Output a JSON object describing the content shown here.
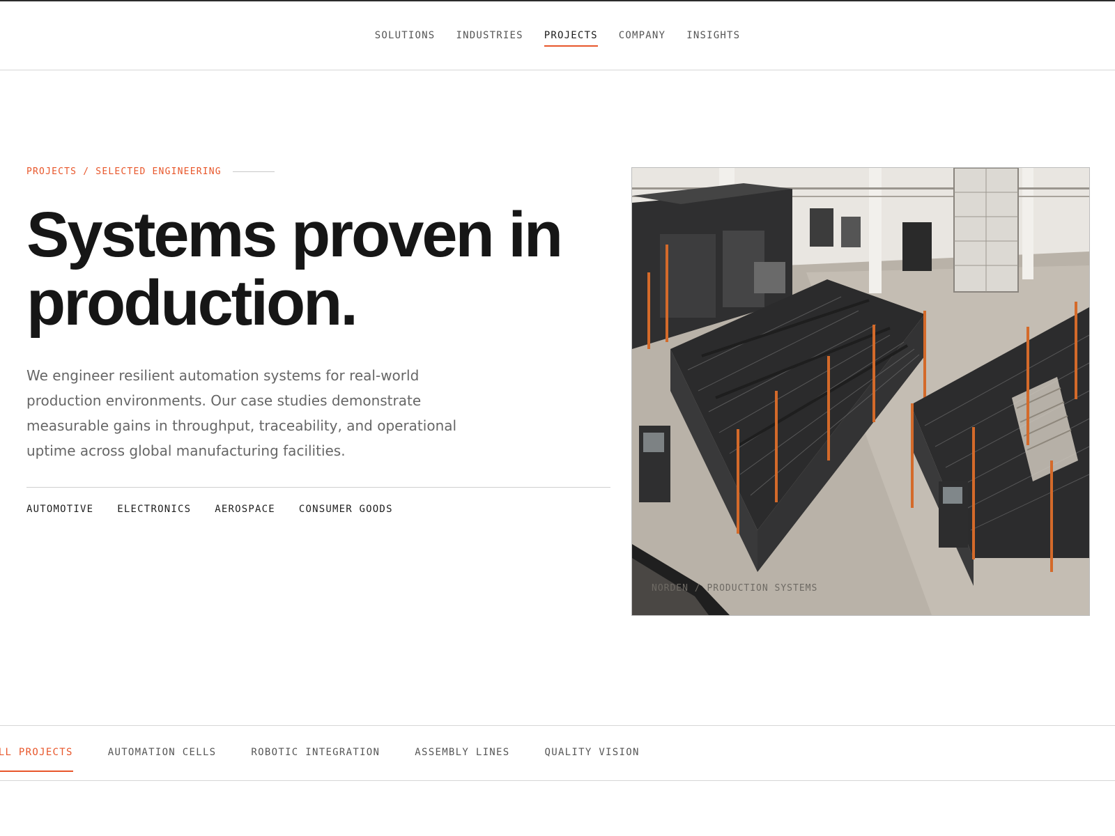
{
  "nav": {
    "items": [
      {
        "label": "SOLUTIONS",
        "active": false
      },
      {
        "label": "INDUSTRIES",
        "active": false
      },
      {
        "label": "PROJECTS",
        "active": true
      },
      {
        "label": "COMPANY",
        "active": false
      },
      {
        "label": "INSIGHTS",
        "active": false
      }
    ]
  },
  "hero": {
    "eyebrow": "PROJECTS / SELECTED ENGINEERING",
    "headline_line1": "Systems proven in",
    "headline_line2": "production.",
    "lede": "We engineer resilient automation systems for real-world production environments. Our case studies demonstrate measurable gains in throughput, traceability, and operational uptime across global manufacturing facilities.",
    "industries": [
      "AUTOMOTIVE",
      "ELECTRONICS",
      "AEROSPACE",
      "CONSUMER GOODS"
    ],
    "image_caption": "NORDEN / PRODUCTION SYSTEMS"
  },
  "filters": {
    "tabs": [
      {
        "label": "ALL PROJECTS",
        "active": true
      },
      {
        "label": "AUTOMATION CELLS",
        "active": false
      },
      {
        "label": "ROBOTIC INTEGRATION",
        "active": false
      },
      {
        "label": "ASSEMBLY LINES",
        "active": false
      },
      {
        "label": "QUALITY VISION",
        "active": false
      }
    ]
  },
  "colors": {
    "accent": "#e8562a",
    "text": "#161616",
    "muted": "#666666",
    "rule": "#d6d6d6"
  }
}
